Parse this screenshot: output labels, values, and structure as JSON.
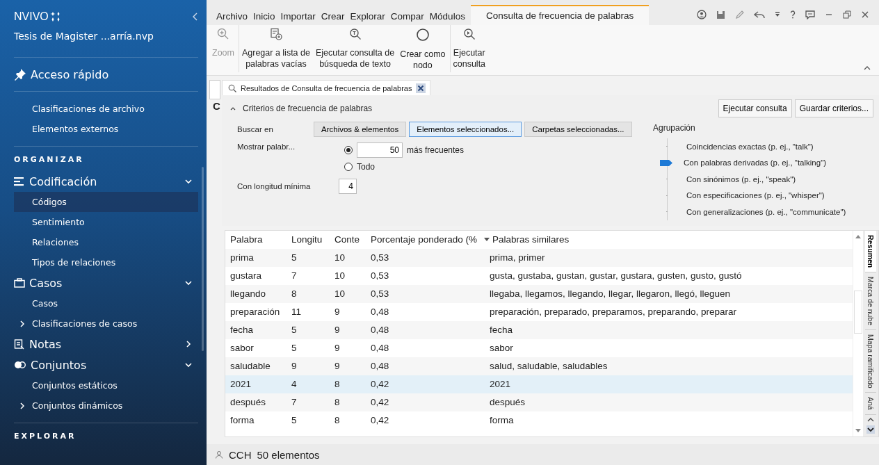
{
  "sidebar": {
    "logo": "NVIVO",
    "project": "Tesis de Magister ...arría.nvp",
    "quick_access": {
      "label": "Acceso rápido",
      "items": [
        {
          "label": "Clasificaciones de archivo",
          "selected": false
        },
        {
          "label": "Elementos externos",
          "selected": false
        }
      ]
    },
    "sections": [
      {
        "heading": "ORGANIZAR",
        "groups": [
          {
            "label": "Codificación",
            "kind": "coding",
            "expanded": true,
            "items": [
              {
                "label": "Códigos",
                "kind": "leaf",
                "selected": true
              },
              {
                "label": "Sentimiento",
                "kind": "leaf",
                "selected": false
              },
              {
                "label": "Relaciones",
                "kind": "leaf",
                "selected": false
              },
              {
                "label": "Tipos de relaciones",
                "kind": "leaf",
                "selected": false
              }
            ]
          },
          {
            "label": "Casos",
            "kind": "cases",
            "expanded": true,
            "items": [
              {
                "label": "Casos",
                "kind": "leaf",
                "selected": false
              },
              {
                "label": "Clasificaciones de casos",
                "kind": "folder",
                "selected": false
              }
            ]
          },
          {
            "label": "Notas",
            "kind": "notes",
            "expanded": false
          },
          {
            "label": "Conjuntos",
            "kind": "sets",
            "expanded": true,
            "items": [
              {
                "label": "Conjuntos estáticos",
                "kind": "leaf",
                "selected": false
              },
              {
                "label": "Conjuntos dinámicos",
                "kind": "folder",
                "selected": false
              }
            ]
          }
        ]
      },
      {
        "heading": "EXPLORAR"
      }
    ]
  },
  "ribbon_tabs": [
    {
      "label": "Archivo",
      "selected": false
    },
    {
      "label": "Inicio",
      "selected": false
    },
    {
      "label": "Importar",
      "selected": false
    },
    {
      "label": "Crear",
      "selected": false
    },
    {
      "label": "Explorar",
      "selected": false
    },
    {
      "label": "Compar",
      "selected": false
    },
    {
      "label": "Módulos",
      "selected": false
    },
    {
      "label": "Consulta de frecuencia de palabras",
      "selected": true
    }
  ],
  "ribbon_buttons": [
    {
      "label": "Zoom",
      "disabled": true
    },
    {
      "label": "Agregar a lista de\npalabras vacías",
      "disabled": false
    },
    {
      "label": "Ejecutar consulta de\nbúsqueda de texto",
      "disabled": false
    },
    {
      "label": "Crear como\nnodo",
      "disabled": false
    },
    {
      "label": "Ejecutar\nconsulta",
      "disabled": false
    }
  ],
  "collapsed_panel": {
    "title": "C"
  },
  "document_tab": {
    "title": "Resultados de Consulta de frecuencia de palabras"
  },
  "criteria": {
    "title": "Criterios de frecuencia de palabras",
    "actions": [
      "Ejecutar consulta",
      "Guardar criterios..."
    ],
    "search_in": {
      "label": "Buscar en",
      "options": [
        {
          "label": "Archivos & elementos",
          "selected": false
        },
        {
          "label": "Elementos seleccionados...",
          "selected": true
        },
        {
          "label": "Carpetas seleccionadas...",
          "selected": false
        }
      ]
    },
    "show_words": {
      "label": "Mostrar palabr...",
      "options": [
        {
          "value": "50",
          "suffix": "más frecuentes",
          "selected": true
        },
        {
          "label": "Todo",
          "selected": false
        }
      ]
    },
    "min_length": {
      "label": "Con longitud mínima",
      "value": "4"
    },
    "grouping": {
      "label": "Agrupación",
      "options": [
        {
          "label": "Coincidencias exactas (p. ej., \"talk\")",
          "selected": false
        },
        {
          "label": "Con palabras derivadas (p. ej., \"talking\")",
          "selected": true
        },
        {
          "label": "Con sinónimos (p. ej., \"speak\")",
          "selected": false
        },
        {
          "label": "Con especificaciones (p. ej., \"whisper\")",
          "selected": false
        },
        {
          "label": "Con generalizaciones (p. ej., \"communicate\")",
          "selected": false
        }
      ]
    }
  },
  "table": {
    "columns": [
      {
        "label": "Palabra",
        "sorted": false
      },
      {
        "label": "Longitu",
        "sorted": false
      },
      {
        "label": "Conte",
        "sorted": false
      },
      {
        "label": "Porcentaje ponderado (%",
        "sorted": false
      },
      {
        "label": "Palabras similares",
        "sorted": true
      }
    ],
    "rows": [
      {
        "cells": [
          "prima",
          "5",
          "10",
          "0,53",
          "prima, primer"
        ],
        "selected": false
      },
      {
        "cells": [
          "gustara",
          "7",
          "10",
          "0,53",
          "gusta, gustaba, gustan, gustar, gustara, gusten, gusto, gustó"
        ],
        "selected": false
      },
      {
        "cells": [
          "llegando",
          "8",
          "10",
          "0,53",
          "llegaba, llegamos, llegando, llegar, llegaron, llegó, lleguen"
        ],
        "selected": false
      },
      {
        "cells": [
          "preparación",
          "11",
          "9",
          "0,48",
          "preparación, preparado, preparamos, preparando, preparar"
        ],
        "selected": false
      },
      {
        "cells": [
          "fecha",
          "5",
          "9",
          "0,48",
          "fecha"
        ],
        "selected": false
      },
      {
        "cells": [
          "sabor",
          "5",
          "9",
          "0,48",
          "sabor"
        ],
        "selected": false
      },
      {
        "cells": [
          "saludable",
          "9",
          "9",
          "0,48",
          "salud, saludable, saludables"
        ],
        "selected": false
      },
      {
        "cells": [
          "2021",
          "4",
          "8",
          "0,42",
          "2021"
        ],
        "selected": true
      },
      {
        "cells": [
          "después",
          "7",
          "8",
          "0,42",
          "después"
        ],
        "selected": false
      },
      {
        "cells": [
          "forma",
          "5",
          "8",
          "0,42",
          "forma"
        ],
        "selected": false
      }
    ]
  },
  "view_tabs": [
    {
      "label": "Resumen",
      "selected": true
    },
    {
      "label": "Marca de nube",
      "selected": false
    },
    {
      "label": "Mapa ramificado",
      "selected": false
    },
    {
      "label": "Aná",
      "selected": false
    }
  ],
  "status_bar": {
    "user": "CCH",
    "count": "50 elementos"
  }
}
